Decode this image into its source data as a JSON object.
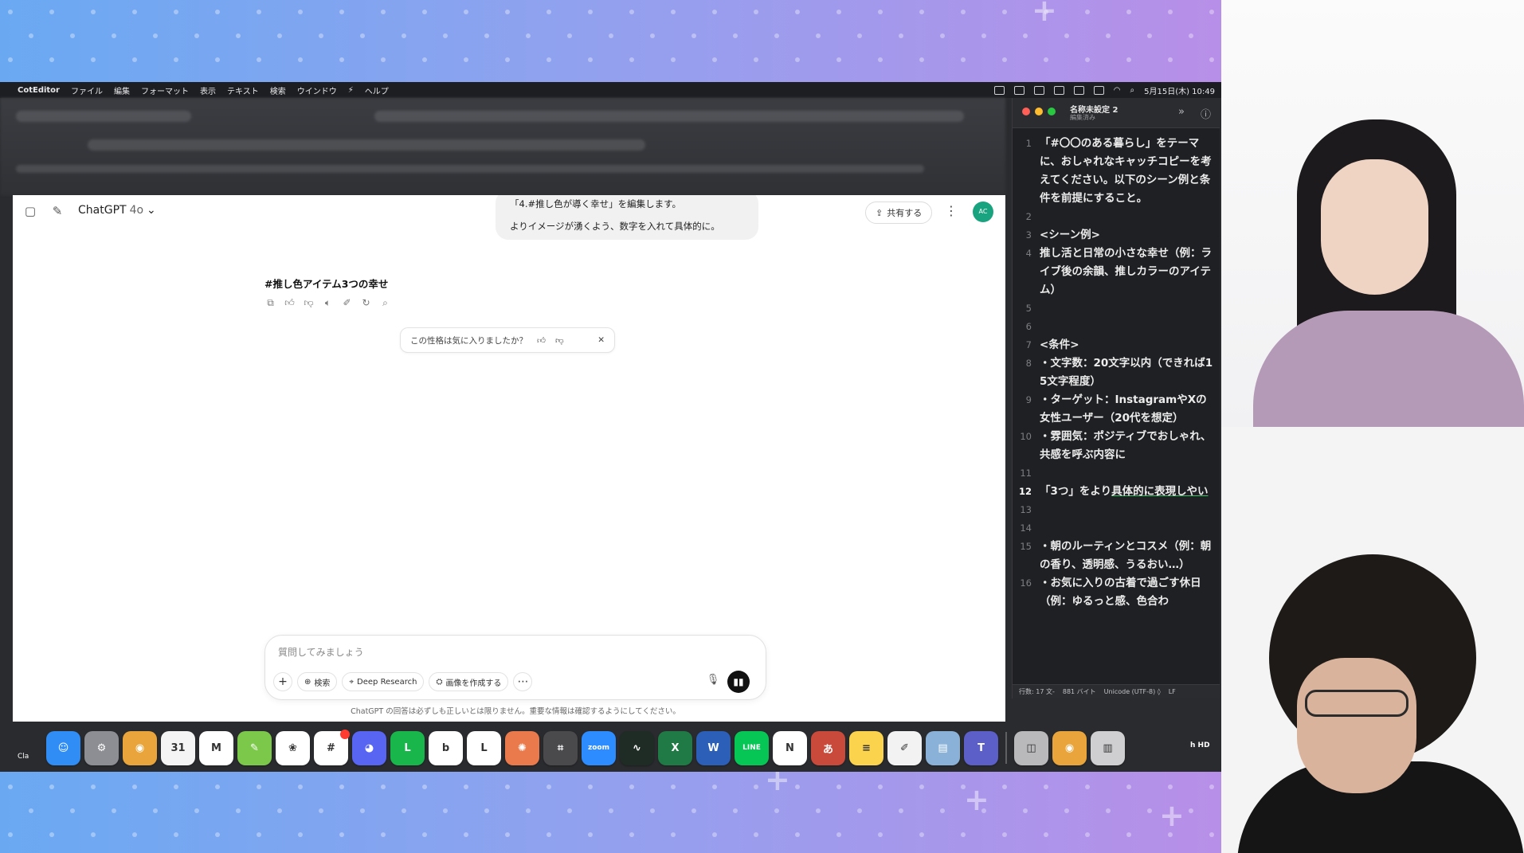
{
  "menubar": {
    "apple": "",
    "app_name": "CotEditor",
    "items": [
      "ファイル",
      "編集",
      "フォーマット",
      "表示",
      "テキスト",
      "検索",
      "ウインドウ",
      "⚡",
      "ヘルプ"
    ],
    "clock": "5月15日(木) 10:49"
  },
  "chatgpt": {
    "model_name": "ChatGPT",
    "model_version": "4o",
    "share_label": "共有する",
    "avatar_initials": "AC",
    "user_message_line1": "「4.#推し色が導く幸せ」を編集します。",
    "user_message_line2": "よりイメージが湧くよう、数字を入れて具体的に。",
    "answer_title": "#推し色アイテム3つの幸せ",
    "feedback_question": "この性格は気に入りましたか？",
    "composer_placeholder": "質問してみましょう",
    "tool_search": "検索",
    "tool_deep_research": "Deep Research",
    "tool_create_image": "画像を作成する",
    "disclaimer": "ChatGPT の回答は必ずしも正しいとは限りません。重要な情報は確認するようにしてください。"
  },
  "coteditor": {
    "title": "名称未設定 2",
    "subtitle": "編集済み",
    "lines": [
      {
        "num": "1",
        "text": "「#〇〇のある暮らし」をテーマに、おしゃれなキャッチコピーを考えてください。以下のシーン例と条件を前提にすること。"
      },
      {
        "num": "2",
        "text": ""
      },
      {
        "num": "3",
        "text": "<シーン例>"
      },
      {
        "num": "4",
        "text": "推し活と日常の小さな幸せ（例：ライブ後の余韻、推しカラーのアイテム）"
      },
      {
        "num": "5",
        "text": ""
      },
      {
        "num": "6",
        "text": ""
      },
      {
        "num": "7",
        "text": "<条件>"
      },
      {
        "num": "8",
        "text": "・文字数：20文字以内（できれば15文字程度）"
      },
      {
        "num": "9",
        "text": "・ターゲット：InstagramやXの女性ユーザー（20代を想定）"
      },
      {
        "num": "10",
        "text": "・雰囲気：ポジティブでおしゃれ、共感を呼ぶ内容に"
      },
      {
        "num": "11",
        "text": ""
      },
      {
        "num": "12",
        "text_plain": "「3つ」をより",
        "text_marked": "具体的に表現しやい"
      },
      {
        "num": "13",
        "text": ""
      },
      {
        "num": "14",
        "text": ""
      },
      {
        "num": "15",
        "text": "・朝のルーティンとコスメ（例：朝の香り、透明感、うるおい…）"
      },
      {
        "num": "16",
        "text": "・お気に入りの古着で過ごす休日（例：ゆるっと感、色合わ"
      }
    ],
    "status_position": "行数: 17  文-",
    "status_bytes": "881 バイト",
    "status_encoding": "Unicode (UTF-8) ◊",
    "status_lineending": "LF"
  },
  "dock": {
    "label_left": "Cla",
    "label_right": "h HD",
    "apps": [
      {
        "name": "finder",
        "label": "☺",
        "color": "#2f8df5"
      },
      {
        "name": "system-settings",
        "label": "⚙",
        "color": "#8d8e93"
      },
      {
        "name": "chrome",
        "label": "◉",
        "color": "#e9a53b"
      },
      {
        "name": "calendar",
        "label": "31",
        "color": "#f4f4f4"
      },
      {
        "name": "gmail",
        "label": "M",
        "color": "#ffffff"
      },
      {
        "name": "pencil-app",
        "label": "✎",
        "color": "#7cc84a"
      },
      {
        "name": "scrapbox",
        "label": "❀",
        "color": "#ffffff"
      },
      {
        "name": "slack",
        "label": "#",
        "color": "#ffffff"
      },
      {
        "name": "discord",
        "label": "◕",
        "color": "#5865f2"
      },
      {
        "name": "line-works",
        "label": "L",
        "color": "#19b64c"
      },
      {
        "name": "bing",
        "label": "b",
        "color": "#ffffff"
      },
      {
        "name": "notebook",
        "label": "L",
        "color": "#ffffff"
      },
      {
        "name": "claude",
        "label": "✺",
        "color": "#ea7a4c"
      },
      {
        "name": "calculator",
        "label": "⌗",
        "color": "#4a4a4d"
      },
      {
        "name": "zoom",
        "label": "zoom",
        "color": "#2d8cff"
      },
      {
        "name": "activity-monitor",
        "label": "∿",
        "color": "#1f2b25"
      },
      {
        "name": "excel",
        "label": "X",
        "color": "#1f7a45"
      },
      {
        "name": "word",
        "label": "W",
        "color": "#2b5fb8"
      },
      {
        "name": "line",
        "label": "LINE",
        "color": "#06c755"
      },
      {
        "name": "notion",
        "label": "N",
        "color": "#ffffff"
      },
      {
        "name": "kotoeri",
        "label": "あ",
        "color": "#c94a3b"
      },
      {
        "name": "notes",
        "label": "≡",
        "color": "#fbd34d"
      },
      {
        "name": "textedit",
        "label": "✐",
        "color": "#f2f2f2"
      },
      {
        "name": "preview",
        "label": "▤",
        "color": "#8ab2d8"
      },
      {
        "name": "teams",
        "label": "T",
        "color": "#5b5fc7"
      },
      {
        "name": "disk",
        "label": "◫",
        "color": "#b9b9bc"
      },
      {
        "name": "chrome-small",
        "label": "◉",
        "color": "#e9a53b"
      },
      {
        "name": "trash",
        "label": "▥",
        "color": "#cfcfd2"
      }
    ]
  }
}
